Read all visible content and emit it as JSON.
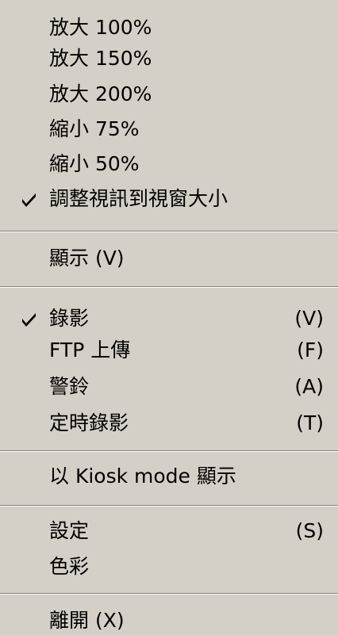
{
  "menu": {
    "zoom_100": "放大 100%",
    "zoom_150": "放大 150%",
    "zoom_200": "放大 200%",
    "shrink_75": "縮小 75%",
    "shrink_50": "縮小 50%",
    "fit_window": "調整視訊到視窗大小",
    "fit_window_checked": true,
    "display": "顯示 (V)",
    "record": "錄影",
    "record_shortcut": "(V)",
    "record_checked": true,
    "ftp_upload": "FTP 上傳",
    "ftp_upload_shortcut": "(F)",
    "alarm": "警鈴",
    "alarm_shortcut": "(A)",
    "scheduled_record": "定時錄影",
    "scheduled_record_shortcut": "(T)",
    "kiosk_display": "以 Kiosk mode 顯示",
    "settings": "設定",
    "settings_shortcut": "(S)",
    "color": "色彩",
    "exit": "離開 (X)"
  },
  "icons": {
    "check": "checkmark-icon"
  },
  "colors": {
    "menu_background": "#d4d0c8",
    "separator_shadow": "#808080",
    "separator_highlight": "#ffffff",
    "text": "#000000"
  }
}
